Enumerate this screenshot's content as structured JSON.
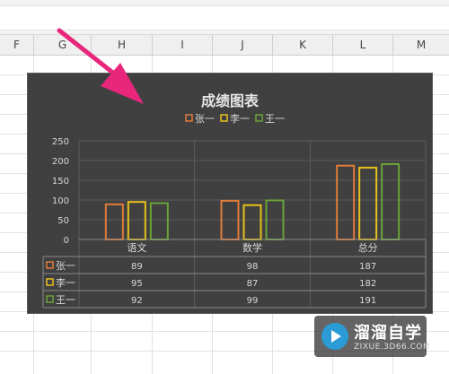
{
  "spreadsheet": {
    "columns": [
      "F",
      "G",
      "H",
      "I",
      "J",
      "K",
      "L",
      "M"
    ]
  },
  "chart_data": {
    "type": "bar",
    "title": "成绩图表",
    "categories": [
      "语文",
      "数学",
      "总分"
    ],
    "series": [
      {
        "name": "张一",
        "values": [
          89,
          98,
          187
        ],
        "color": "#e07b39"
      },
      {
        "name": "李一",
        "values": [
          95,
          87,
          182
        ],
        "color": "#e8c11a"
      },
      {
        "name": "王一",
        "values": [
          92,
          99,
          191
        ],
        "color": "#6aa339"
      }
    ],
    "ylim": [
      0,
      250
    ],
    "yticks": [
      "0",
      "50",
      "100",
      "150",
      "200",
      "250"
    ],
    "grid": true,
    "legend": "top",
    "data_table": true
  },
  "watermark": {
    "title": "溜溜自学",
    "subtitle": "ZIXUE.3D66.COM"
  },
  "annotation": {
    "arrow_color": "#e8267c"
  }
}
